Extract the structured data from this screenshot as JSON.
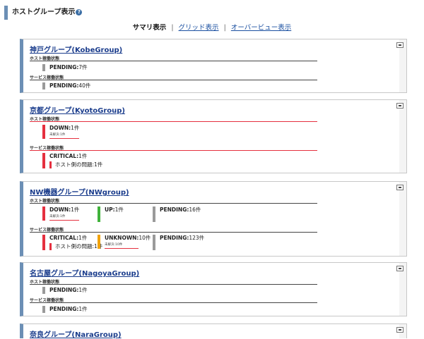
{
  "page": {
    "title": "ホストグループ表示",
    "help_glyph": "?"
  },
  "nav": {
    "current": "サマリ表示",
    "sep1": "|",
    "grid": "グリッド表示",
    "sep2": "|",
    "overview": "オーバービュー表示"
  },
  "labels": {
    "host": "ホスト稼働状態",
    "service": "サービス稼働状態"
  },
  "groups": [
    {
      "title": "神戸グループ(KobeGroup)",
      "host": [
        {
          "label": "PENDING:",
          "count": "7件"
        }
      ],
      "service": [
        {
          "label": "PENDING:",
          "count": "40件"
        }
      ]
    },
    {
      "title": "京都グループ(KyotoGroup)",
      "host": [
        {
          "label": "DOWN:",
          "count": "1件",
          "sub": "未解決:1件"
        }
      ],
      "service": [
        {
          "label": "CRITICAL:",
          "count": "1件",
          "detail": "ホスト側の問題:1件"
        }
      ]
    },
    {
      "title": "NW機器グループ(NWgroup)",
      "host": [
        {
          "label": "DOWN:",
          "count": "1件",
          "sub": "未解決:1件"
        },
        {
          "label": "UP:",
          "count": "1件"
        },
        {
          "label": "PENDING:",
          "count": "16件"
        }
      ],
      "service": [
        {
          "label": "CRITICAL:",
          "count": "1件",
          "detail": "ホスト側の問題:1件"
        },
        {
          "label": "UNKNOWN:",
          "count": "10件",
          "sub": "未解決:10件"
        },
        {
          "label": "PENDING:",
          "count": "123件"
        }
      ]
    },
    {
      "title": "名古屋グループ(NagoyaGroup)",
      "host": [
        {
          "label": "PENDING:",
          "count": "1件"
        }
      ],
      "service": [
        {
          "label": "PENDING:",
          "count": "1件"
        }
      ]
    },
    {
      "title": "奈良グループ(NaraGroup)"
    }
  ]
}
